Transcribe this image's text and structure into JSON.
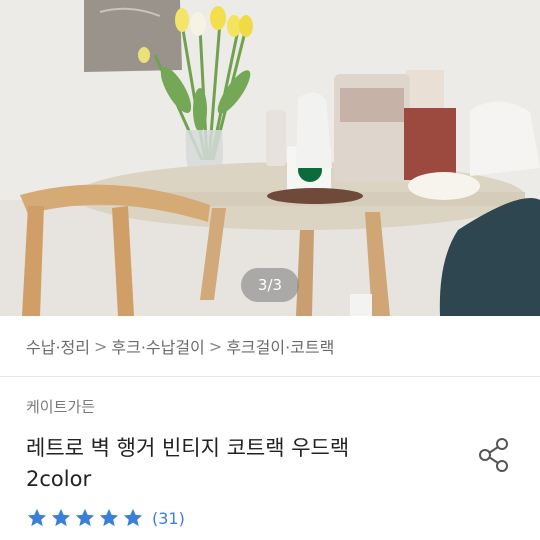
{
  "gallery": {
    "counter": "3/3",
    "image_label": "table-with-tulips-photo"
  },
  "breadcrumb": {
    "items": [
      "수납·정리",
      "후크·수납걸이",
      "후크걸이·코트랙"
    ],
    "separator": ">"
  },
  "product": {
    "seller": "케이트가든",
    "title_line1": "레트로 벽 행거 빈티지 코트랙 우드랙",
    "title_line2": "2color",
    "rating": {
      "stars": 5,
      "max": 5,
      "reviews": "(31)",
      "color": "#3c7fd6"
    },
    "share_icon": "share-icon"
  }
}
